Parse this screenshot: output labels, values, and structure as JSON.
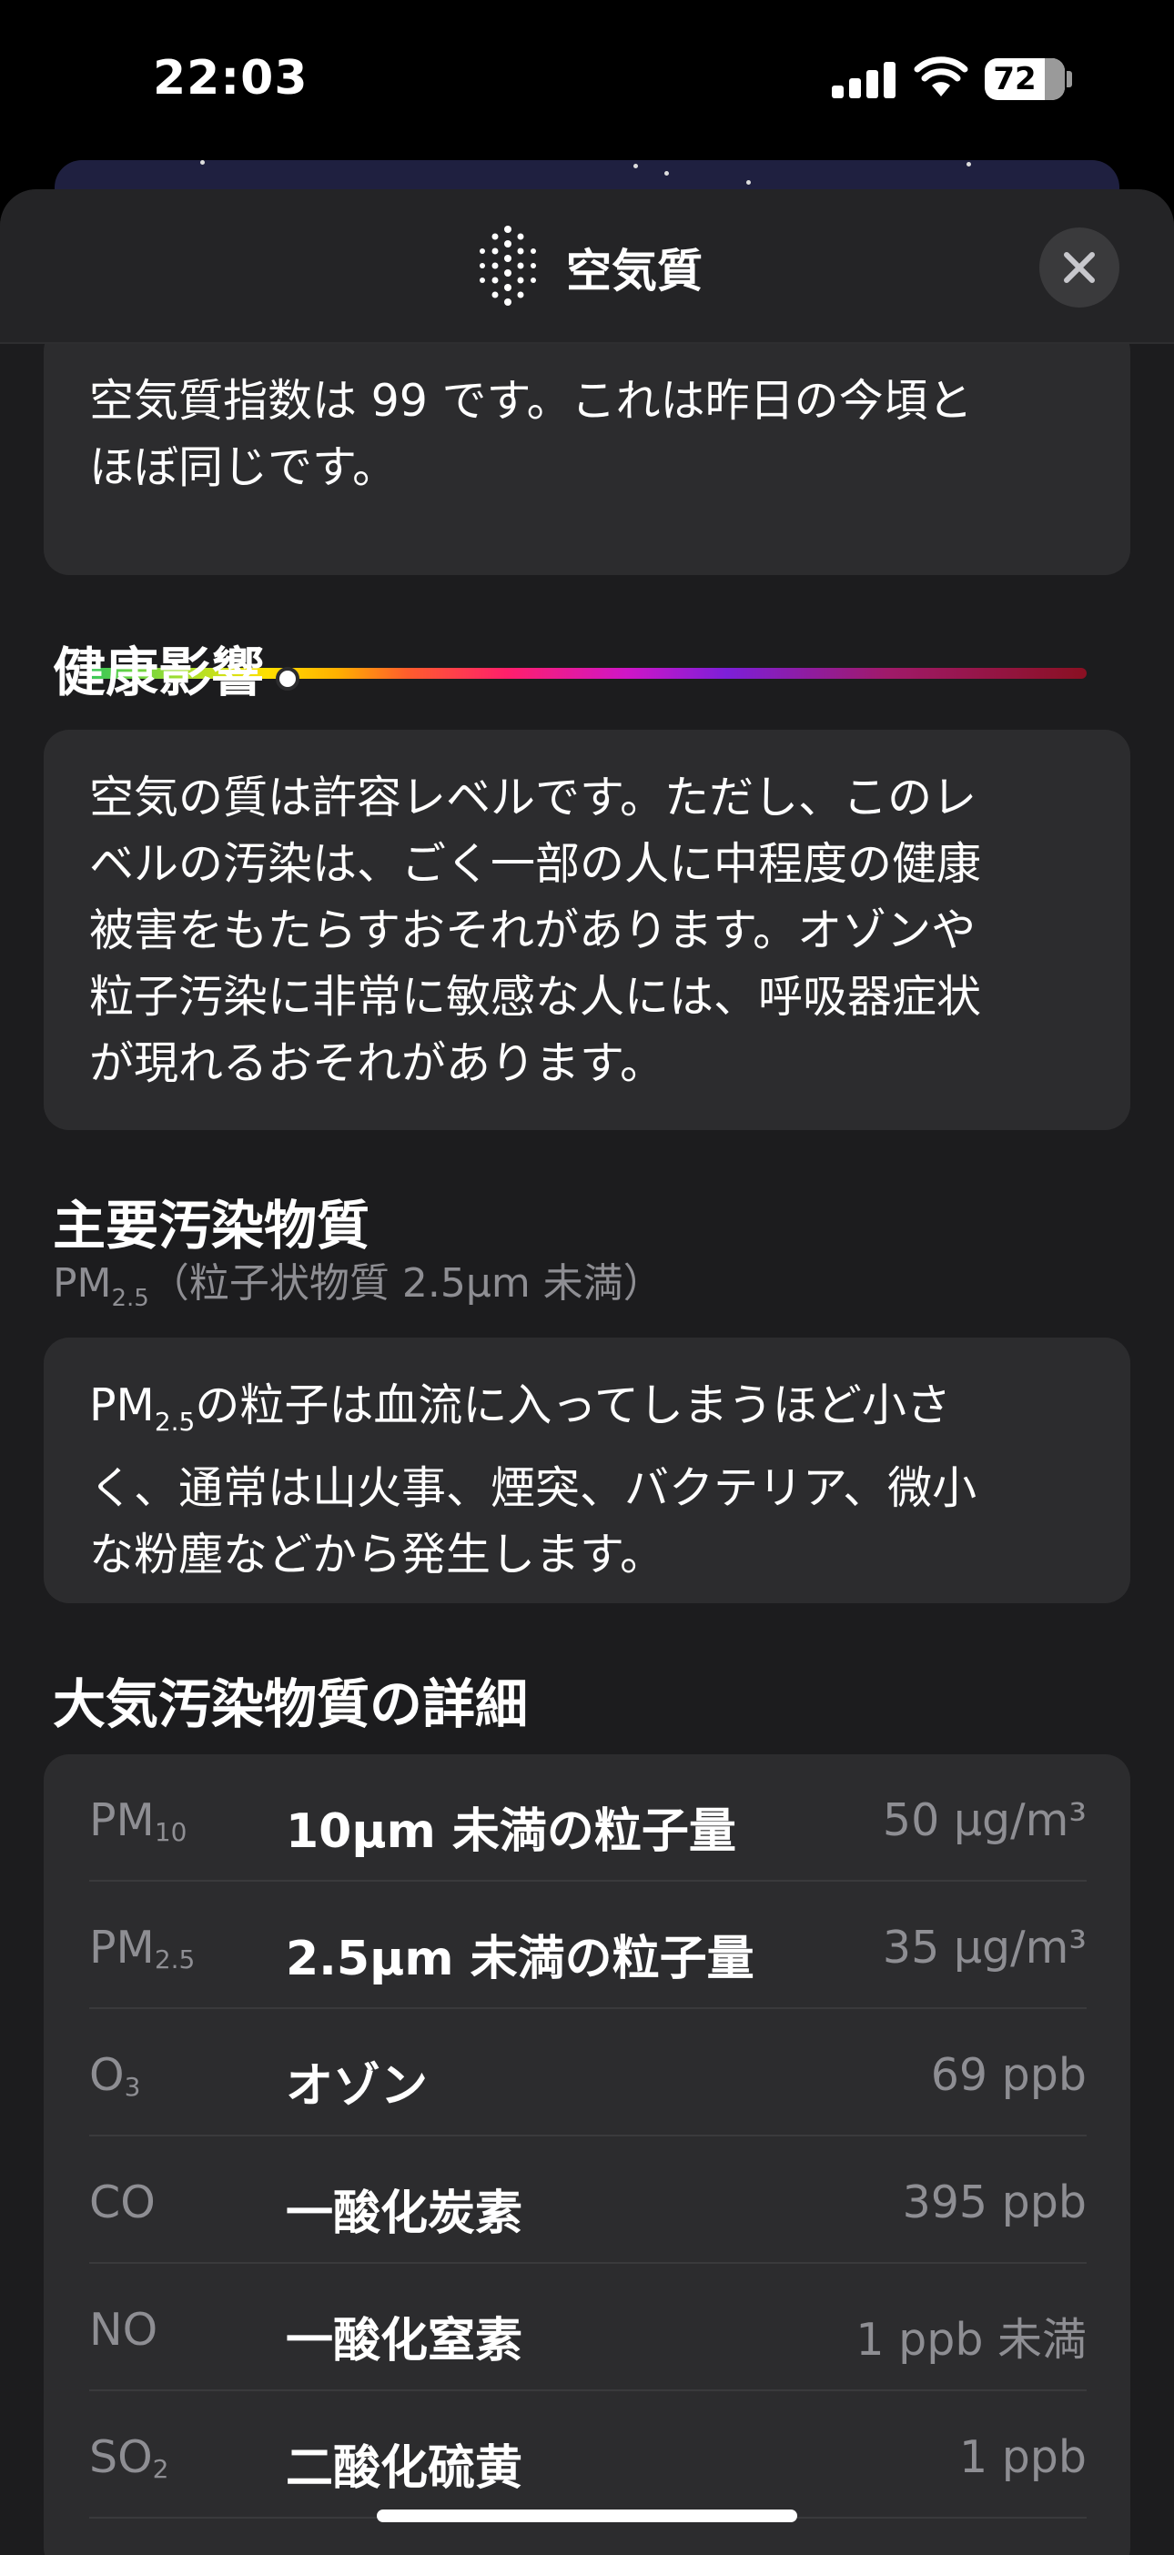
{
  "status_bar": {
    "time": "22:03",
    "battery": "72"
  },
  "header": {
    "title": "空気質",
    "icon": "air-quality-dots-icon",
    "close_icon": "close-icon"
  },
  "aqi_card": {
    "text_line1": "空気質指数は 99 です。これは昨日の今頃と",
    "text_line2": "ほぼ同じです。",
    "indicator_fraction": 0.2
  },
  "health": {
    "title": "健康影響",
    "lines": [
      "空気の質は許容レベルです。ただし、このレ",
      "ベルの汚染は、ごく一部の人に中程度の健康",
      "被害をもたらすおそれがあります。オゾンや",
      "粒子汚染に非常に敏感な人には、呼吸器症状",
      "が現れるおそれがあります。"
    ]
  },
  "primary": {
    "title": "主要汚染物質",
    "subtitle_symbol": "PM",
    "subtitle_sub": "2.5",
    "subtitle_rest": "（粒子状物質 2.5µm 未満）",
    "desc_symbol": "PM",
    "desc_sub": "2.5",
    "desc_line1_rest": "の粒子は血流に入ってしまうほど小さ",
    "desc_line2": "く、通常は山火事、煙突、バクテリア、微小",
    "desc_line3": "な粉塵などから発生します。"
  },
  "details": {
    "title": "大気汚染物質の詳細",
    "rows": [
      {
        "sym": "PM",
        "sub": "10",
        "name": "10µm 未満の粒子量",
        "value": "50 µg/m³"
      },
      {
        "sym": "PM",
        "sub": "2.5",
        "name": "2.5µm 未満の粒子量",
        "value": "35 µg/m³"
      },
      {
        "sym": "O",
        "sub": "3",
        "name": "オゾン",
        "value": "69 ppb"
      },
      {
        "sym": "CO",
        "sub": "",
        "name": "一酸化炭素",
        "value": "395 ppb"
      },
      {
        "sym": "NO",
        "sub": "",
        "name": "一酸化窒素",
        "value": "1 ppb 未満"
      },
      {
        "sym": "SO",
        "sub": "2",
        "name": "二酸化硫黄",
        "value": "1 ppb"
      }
    ]
  }
}
